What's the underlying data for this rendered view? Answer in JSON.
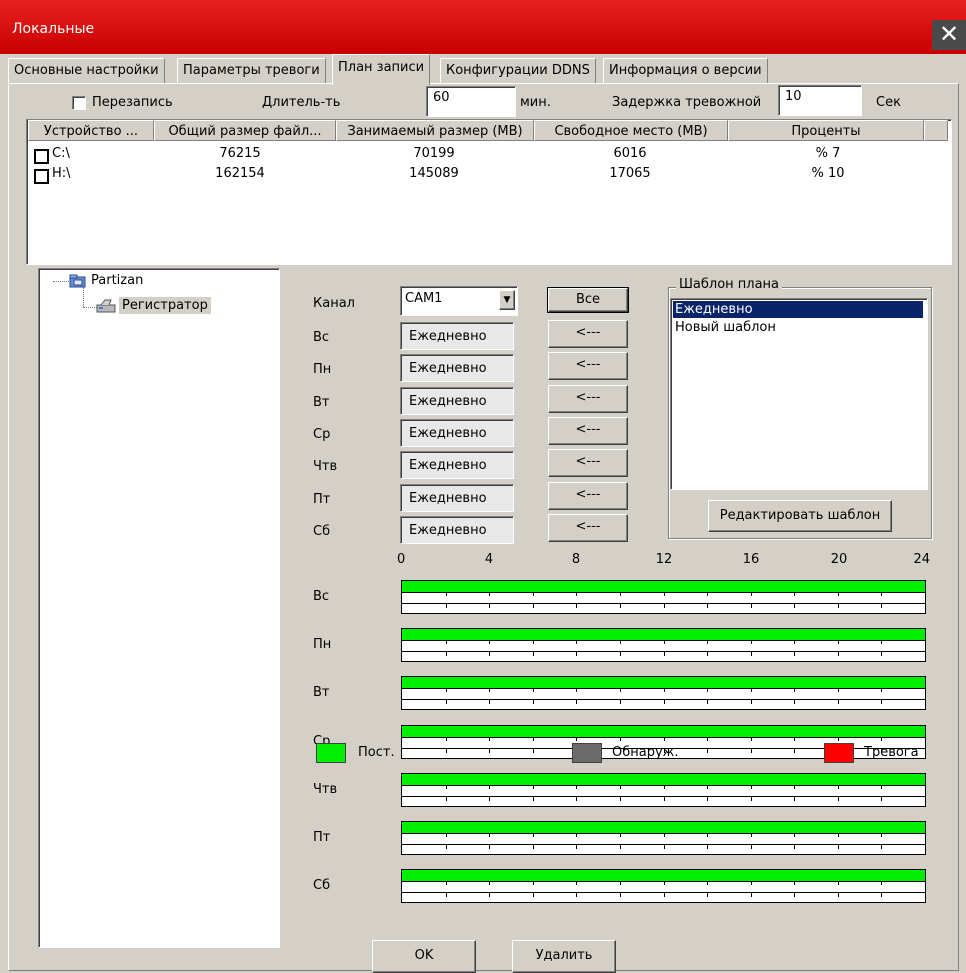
{
  "window": {
    "title": "Локальные",
    "close_glyph": "✕"
  },
  "tabs": [
    {
      "label": "Основные настройки"
    },
    {
      "label": "Параметры тревоги"
    },
    {
      "label": "План записи"
    },
    {
      "label": "Конфигурации DDNS"
    },
    {
      "label": "Информация о версии"
    }
  ],
  "top_settings": {
    "overwrite_label": "Перезапись",
    "duration_label": "Длитель-ть",
    "duration_value": "60",
    "duration_unit": "мин.",
    "alarm_delay_label": "Задержка тревожной",
    "alarm_delay_value": "10",
    "alarm_delay_unit": "Сек"
  },
  "disk_table": {
    "columns": [
      "Устройство ...",
      "Общий размер файл...",
      "Занимаемый размер (MB)",
      "Свободное место (MB)",
      "Проценты"
    ],
    "rows": [
      {
        "device": "C:\\",
        "total": "76215",
        "used": "70199",
        "free": "6016",
        "percent": "% 7"
      },
      {
        "device": "H:\\",
        "total": "162154",
        "used": "145089",
        "free": "17065",
        "percent": "% 10"
      }
    ]
  },
  "tree": {
    "root": "Partizan",
    "child": "Регистратор"
  },
  "schedule": {
    "channel_label": "Канал",
    "channel_value": "CAM1",
    "all_button": "Все",
    "arrow_button": "<---",
    "days": [
      {
        "label": "Вс",
        "template": "Ежедневно"
      },
      {
        "label": "Пн",
        "template": "Ежедневно"
      },
      {
        "label": "Вт",
        "template": "Ежедневно"
      },
      {
        "label": "Ср",
        "template": "Ежедневно"
      },
      {
        "label": "Чтв",
        "template": "Ежедневно"
      },
      {
        "label": "Пт",
        "template": "Ежедневно"
      },
      {
        "label": "Сб",
        "template": "Ежедневно"
      }
    ]
  },
  "template_group": {
    "title": "Шаблон плана",
    "items": [
      "Ежедневно",
      "Новый шаблон"
    ],
    "selected_index": 0,
    "edit_button": "Редактировать шаблон"
  },
  "timeline": {
    "hour_labels": [
      "0",
      "4",
      "8",
      "12",
      "16",
      "20",
      "24"
    ],
    "recording_fraction_per_day": 1.0,
    "colors": {
      "constant": "#00f000",
      "motion": "#6b6b6b",
      "alarm": "#ff0000"
    }
  },
  "legend": {
    "constant": "Пост.",
    "motion": "Обнаруж.",
    "alarm": "Тревога"
  },
  "footer": {
    "ok": "OK",
    "delete": "Удалить"
  }
}
